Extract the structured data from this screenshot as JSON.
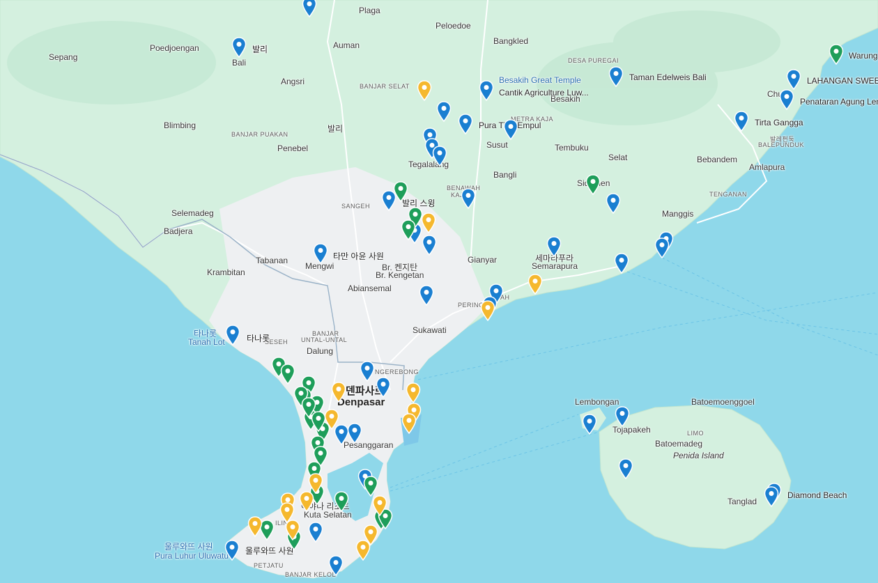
{
  "map": {
    "place_labels": [
      {
        "text": "Plaga",
        "cls": ""
      },
      {
        "text": "Peloedoe",
        "cls": ""
      },
      {
        "text": "Poedjoengan",
        "cls": ""
      },
      {
        "text": "Auman",
        "cls": ""
      },
      {
        "text": "Bangkled",
        "cls": ""
      },
      {
        "text": "Sepang",
        "cls": ""
      },
      {
        "text": "발리",
        "cls": ""
      },
      {
        "text": "Bali",
        "cls": ""
      },
      {
        "text": "DESA PUREGAI",
        "cls": "small"
      },
      {
        "text": "Angsri",
        "cls": ""
      },
      {
        "text": "BANJAR SELAT",
        "cls": "small"
      },
      {
        "text": "Besakih Great Temple",
        "cls": "blue"
      },
      {
        "text": "Besakih",
        "cls": ""
      },
      {
        "text": "Blimbing",
        "cls": ""
      },
      {
        "text": "발리",
        "cls": ""
      },
      {
        "text": "METRA KAJA",
        "cls": "small"
      },
      {
        "text": "BANJAR PUAKAN",
        "cls": "small"
      },
      {
        "text": "Penebel",
        "cls": ""
      },
      {
        "text": "Susut",
        "cls": ""
      },
      {
        "text": "Tembuku",
        "cls": ""
      },
      {
        "text": "Tegalalang",
        "cls": ""
      },
      {
        "text": "Selat",
        "cls": ""
      },
      {
        "text": "Bebandem",
        "cls": ""
      },
      {
        "text": "Amlapura",
        "cls": ""
      },
      {
        "text": "발레펀둑",
        "cls": "small"
      },
      {
        "text": "BALEPUNDUK",
        "cls": "small"
      },
      {
        "text": "Chuh",
        "cls": ""
      },
      {
        "text": "Bangli",
        "cls": ""
      },
      {
        "text": "Sidemen",
        "cls": ""
      },
      {
        "text": "BENAWAH",
        "cls": "small"
      },
      {
        "text": "KAJA",
        "cls": "small"
      },
      {
        "text": "TENGANAN",
        "cls": "small"
      },
      {
        "text": "SANGEH",
        "cls": "small"
      },
      {
        "text": "Selemadeg",
        "cls": ""
      },
      {
        "text": "Manggis",
        "cls": ""
      },
      {
        "text": "Badjera",
        "cls": ""
      },
      {
        "text": "Tabanan",
        "cls": ""
      },
      {
        "text": "Mengwi",
        "cls": ""
      },
      {
        "text": "Br. 켄지탄",
        "cls": ""
      },
      {
        "text": "Br. Kengetan",
        "cls": ""
      },
      {
        "text": "Gianyar",
        "cls": ""
      },
      {
        "text": "세마라푸라",
        "cls": ""
      },
      {
        "text": "Semarapura",
        "cls": ""
      },
      {
        "text": "Krambitan",
        "cls": ""
      },
      {
        "text": "Abiansemal",
        "cls": ""
      },
      {
        "text": "PERING",
        "cls": "small"
      },
      {
        "text": "AH",
        "cls": "small"
      },
      {
        "text": "타나롯",
        "cls": "blue"
      },
      {
        "text": "Tanah Lot",
        "cls": "blue"
      },
      {
        "text": "Sukawati",
        "cls": ""
      },
      {
        "text": "SESEH",
        "cls": "small"
      },
      {
        "text": "BANJAR",
        "cls": "small"
      },
      {
        "text": "UNTAL-UNTAL",
        "cls": "small"
      },
      {
        "text": "Dalung",
        "cls": ""
      },
      {
        "text": "NGEREBONG",
        "cls": "small"
      },
      {
        "text": "덴파사르",
        "cls": "big"
      },
      {
        "text": "Denpasar",
        "cls": "big"
      },
      {
        "text": "Lembongan",
        "cls": ""
      },
      {
        "text": "Batoemoenggoel",
        "cls": ""
      },
      {
        "text": "LIMO",
        "cls": "small"
      },
      {
        "text": "Tojapakeh",
        "cls": ""
      },
      {
        "text": "Batoemadeg",
        "cls": ""
      },
      {
        "text": "Penida Island",
        "cls": "ital"
      },
      {
        "text": "Pesanggaran",
        "cls": ""
      },
      {
        "text": "Tanglad",
        "cls": ""
      },
      {
        "text": "아야나 리조트",
        "cls": ""
      },
      {
        "text": "Kuta Selatan",
        "cls": ""
      },
      {
        "text": "ILIN",
        "cls": "small"
      },
      {
        "text": "울루와뜨 사원",
        "cls": "blue"
      },
      {
        "text": "Pura Luhur Uluwatu",
        "cls": "blue"
      },
      {
        "text": "PETJATU",
        "cls": "small"
      },
      {
        "text": "BANJAR KELOD",
        "cls": "small"
      }
    ],
    "poi_labels": [
      {
        "text": "발리"
      },
      {
        "text": "Taman Edelweis Bali"
      },
      {
        "text": "Cantik Agriculture Luw..."
      },
      {
        "text": "Pura Tirta Empul"
      },
      {
        "text": "LAHANGAN SWEET"
      },
      {
        "text": "Warung"
      },
      {
        "text": "Penataran Agung Lem"
      },
      {
        "text": "Tirta Gangga"
      },
      {
        "text": "발리 스윙"
      },
      {
        "text": "타만 아윤 사원"
      },
      {
        "text": "타나롯"
      },
      {
        "text": "울루와뜨 사원"
      },
      {
        "text": "Diamond Beach"
      }
    ],
    "pins": [
      {
        "color": "blue"
      },
      {
        "color": "blue"
      },
      {
        "color": "blue"
      },
      {
        "color": "blue"
      },
      {
        "color": "blue"
      },
      {
        "color": "blue"
      },
      {
        "color": "blue"
      },
      {
        "color": "blue"
      },
      {
        "color": "blue"
      },
      {
        "color": "blue"
      },
      {
        "color": "blue"
      },
      {
        "color": "blue"
      },
      {
        "color": "blue"
      },
      {
        "color": "blue"
      },
      {
        "color": "blue"
      },
      {
        "color": "blue"
      },
      {
        "color": "blue"
      },
      {
        "color": "blue"
      },
      {
        "color": "blue"
      },
      {
        "color": "blue"
      },
      {
        "color": "blue"
      },
      {
        "color": "blue"
      },
      {
        "color": "blue"
      },
      {
        "color": "blue"
      },
      {
        "color": "blue"
      },
      {
        "color": "blue"
      },
      {
        "color": "blue"
      },
      {
        "color": "blue"
      },
      {
        "color": "blue"
      },
      {
        "color": "blue"
      },
      {
        "color": "blue"
      },
      {
        "color": "blue"
      },
      {
        "color": "blue"
      },
      {
        "color": "blue"
      },
      {
        "color": "blue"
      },
      {
        "color": "green"
      },
      {
        "color": "green"
      },
      {
        "color": "green"
      },
      {
        "color": "green"
      },
      {
        "color": "green"
      },
      {
        "color": "green"
      },
      {
        "color": "green"
      },
      {
        "color": "green"
      },
      {
        "color": "green"
      },
      {
        "color": "green"
      },
      {
        "color": "green"
      },
      {
        "color": "green"
      },
      {
        "color": "green"
      },
      {
        "color": "green"
      },
      {
        "color": "green"
      },
      {
        "color": "green"
      },
      {
        "color": "green"
      },
      {
        "color": "green"
      },
      {
        "color": "green"
      },
      {
        "color": "green"
      },
      {
        "color": "green"
      },
      {
        "color": "green"
      },
      {
        "color": "green"
      },
      {
        "color": "green"
      },
      {
        "color": "green"
      },
      {
        "color": "yellow"
      },
      {
        "color": "yellow"
      },
      {
        "color": "yellow"
      },
      {
        "color": "yellow"
      },
      {
        "color": "yellow"
      },
      {
        "color": "yellow"
      },
      {
        "color": "yellow"
      },
      {
        "color": "yellow"
      },
      {
        "color": "yellow"
      },
      {
        "color": "yellow"
      },
      {
        "color": "yellow"
      },
      {
        "color": "yellow"
      },
      {
        "color": "yellow"
      },
      {
        "color": "yellow"
      },
      {
        "color": "yellow"
      },
      {
        "color": "yellow"
      },
      {
        "color": "yellow"
      },
      {
        "color": "yellow"
      }
    ]
  },
  "colors": {
    "sea": "#8fd8ea",
    "land": "#d4f0df",
    "urban": "#f2f3f4",
    "pin_blue": "#1a7fd1",
    "pin_green": "#1e9e5a",
    "pin_yellow": "#f5b82e"
  }
}
